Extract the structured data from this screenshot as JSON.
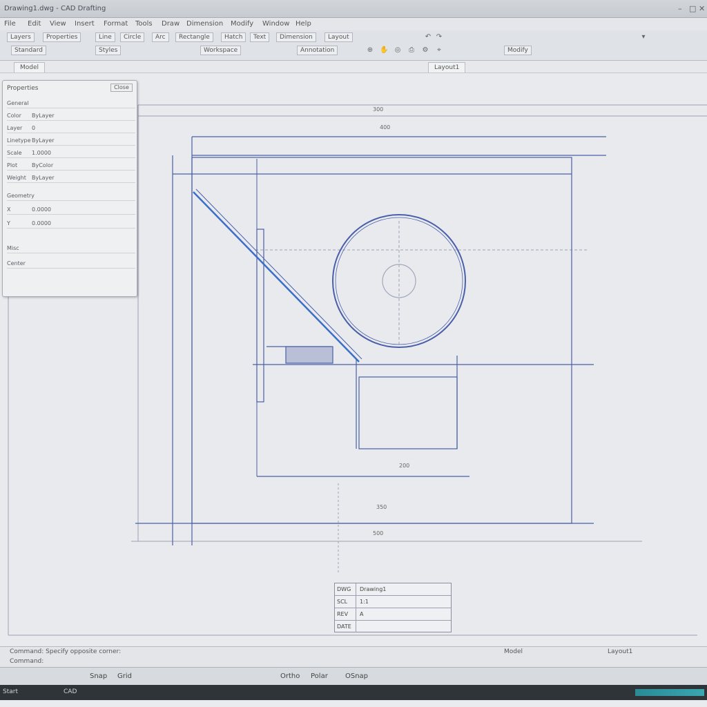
{
  "window": {
    "title": "Drawing1.dwg - CAD Drafting",
    "controls": [
      "–",
      "□",
      "✕"
    ]
  },
  "menu": {
    "items": [
      "File",
      "Edit",
      "View",
      "Insert",
      "Format",
      "Tools",
      "Draw",
      "Dimension",
      "Modify",
      "Window",
      "Help"
    ]
  },
  "toolbar": {
    "row1": [
      "Layers",
      "Properties",
      "Line",
      "Circle",
      "Arc",
      "Rectangle",
      "Hatch",
      "Text",
      "Dimension",
      "Layout"
    ],
    "row2": [
      "Standard",
      "Styles",
      "Workspace",
      "Annotation",
      "Modify"
    ]
  },
  "tabs": {
    "model": "Model",
    "layout": "Layout1"
  },
  "properties_panel": {
    "title": "Properties",
    "close": "Close",
    "rows": [
      {
        "k": "General",
        "v": ""
      },
      {
        "k": "Color",
        "v": "ByLayer"
      },
      {
        "k": "Layer",
        "v": "0"
      },
      {
        "k": "Linetype",
        "v": "ByLayer"
      },
      {
        "k": "Scale",
        "v": "1.0000"
      },
      {
        "k": "Plot",
        "v": "ByColor"
      },
      {
        "k": "Weight",
        "v": "ByLayer"
      },
      {
        "k": "Geometry",
        "v": ""
      },
      {
        "k": "X",
        "v": "0.0000"
      },
      {
        "k": "Y",
        "v": "0.0000"
      },
      {
        "k": "Misc",
        "v": ""
      },
      {
        "k": "Center",
        "v": ""
      }
    ]
  },
  "drawing": {
    "dim_top": "400",
    "dim_upper": "300",
    "dim_inner_bottom": "200",
    "dim_lower": "350",
    "dim_base": "500"
  },
  "title_block": {
    "rows": [
      {
        "k": "DWG",
        "v": "Drawing1"
      },
      {
        "k": "SCL",
        "v": "1:1"
      },
      {
        "k": "REV",
        "v": "A"
      },
      {
        "k": "DATE",
        "v": ""
      }
    ]
  },
  "command": {
    "history": "Command: Specify opposite corner:",
    "prompt": "Command:",
    "coords": "Model",
    "right": "Layout1"
  },
  "status": {
    "icons": [
      "Snap",
      "Grid",
      "Ortho",
      "Polar",
      "OSnap"
    ]
  },
  "taskbar": {
    "start": "Start",
    "app": "CAD"
  },
  "colors": {
    "line": "#4a5fa8",
    "accent": "#3b6fc7"
  }
}
